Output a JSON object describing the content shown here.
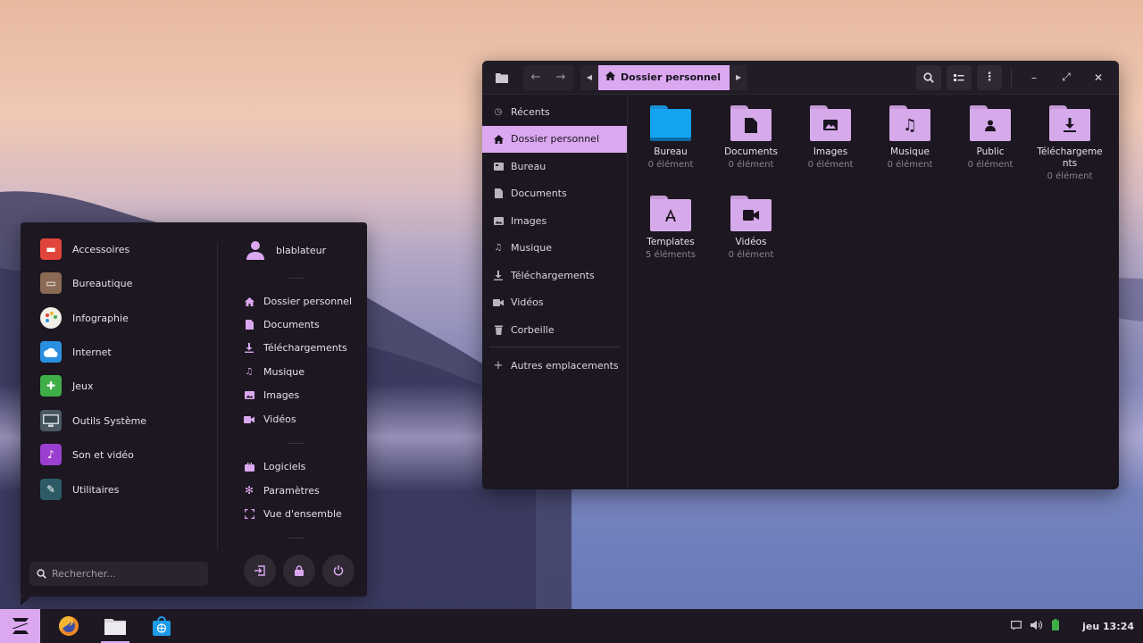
{
  "file_manager": {
    "path_crumb": "Dossier personnel",
    "sidebar": [
      {
        "label": "Récents",
        "icon": "clock-icon"
      },
      {
        "label": "Dossier personnel",
        "icon": "home-icon",
        "active": true
      },
      {
        "label": "Bureau",
        "icon": "desktop-icon"
      },
      {
        "label": "Documents",
        "icon": "document-icon"
      },
      {
        "label": "Images",
        "icon": "image-icon"
      },
      {
        "label": "Musique",
        "icon": "music-icon"
      },
      {
        "label": "Téléchargements",
        "icon": "download-icon"
      },
      {
        "label": "Vidéos",
        "icon": "video-icon"
      },
      {
        "label": "Corbeille",
        "icon": "trash-icon"
      }
    ],
    "other_locations": "Autres emplacements",
    "folders": [
      {
        "name": "Bureau",
        "count": "0 élément",
        "icon": "desktop-folder-icon"
      },
      {
        "name": "Documents",
        "count": "0 élément",
        "icon": "documents-folder-icon"
      },
      {
        "name": "Images",
        "count": "0 élément",
        "icon": "images-folder-icon"
      },
      {
        "name": "Musique",
        "count": "0 élément",
        "icon": "music-folder-icon"
      },
      {
        "name": "Public",
        "count": "0 élément",
        "icon": "public-folder-icon"
      },
      {
        "name": "Téléchargements",
        "count": "0 élément",
        "icon": "downloads-folder-icon"
      },
      {
        "name": "Templates",
        "count": "5 éléments",
        "icon": "templates-folder-icon"
      },
      {
        "name": "Vidéos",
        "count": "0 élément",
        "icon": "videos-folder-icon"
      }
    ]
  },
  "menu": {
    "categories": [
      {
        "label": "Accessoires",
        "icon": "accessories-icon",
        "color": "#e0443a"
      },
      {
        "label": "Bureautique",
        "icon": "office-icon",
        "color": "#8b6a55"
      },
      {
        "label": "Infographie",
        "icon": "graphics-icon",
        "color": "#f2efe8"
      },
      {
        "label": "Internet",
        "icon": "internet-icon",
        "color": "#2b8fe0"
      },
      {
        "label": "Jeux",
        "icon": "games-icon",
        "color": "#3fae48"
      },
      {
        "label": "Outils Système",
        "icon": "system-tools-icon",
        "color": "#4a5862"
      },
      {
        "label": "Son et vidéo",
        "icon": "sound-video-icon",
        "color": "#9a3fd0"
      },
      {
        "label": "Utilitaires",
        "icon": "utilities-icon",
        "color": "#2c5b66"
      }
    ],
    "user": "blablateur",
    "places": [
      {
        "label": "Dossier personnel",
        "icon": "home-icon"
      },
      {
        "label": "Documents",
        "icon": "document-icon"
      },
      {
        "label": "Téléchargements",
        "icon": "download-icon"
      },
      {
        "label": "Musique",
        "icon": "music-icon"
      },
      {
        "label": "Images",
        "icon": "image-icon"
      },
      {
        "label": "Vidéos",
        "icon": "video-icon"
      }
    ],
    "system": [
      {
        "label": "Logiciels",
        "icon": "software-icon"
      },
      {
        "label": "Paramètres",
        "icon": "settings-icon"
      },
      {
        "label": "Vue d'ensemble",
        "icon": "overview-icon"
      }
    ],
    "search_placeholder": "Rechercher..."
  },
  "taskbar": {
    "clock": "jeu 13:24"
  },
  "colors": {
    "accent": "#dba8f0",
    "panel": "#1c1720"
  }
}
